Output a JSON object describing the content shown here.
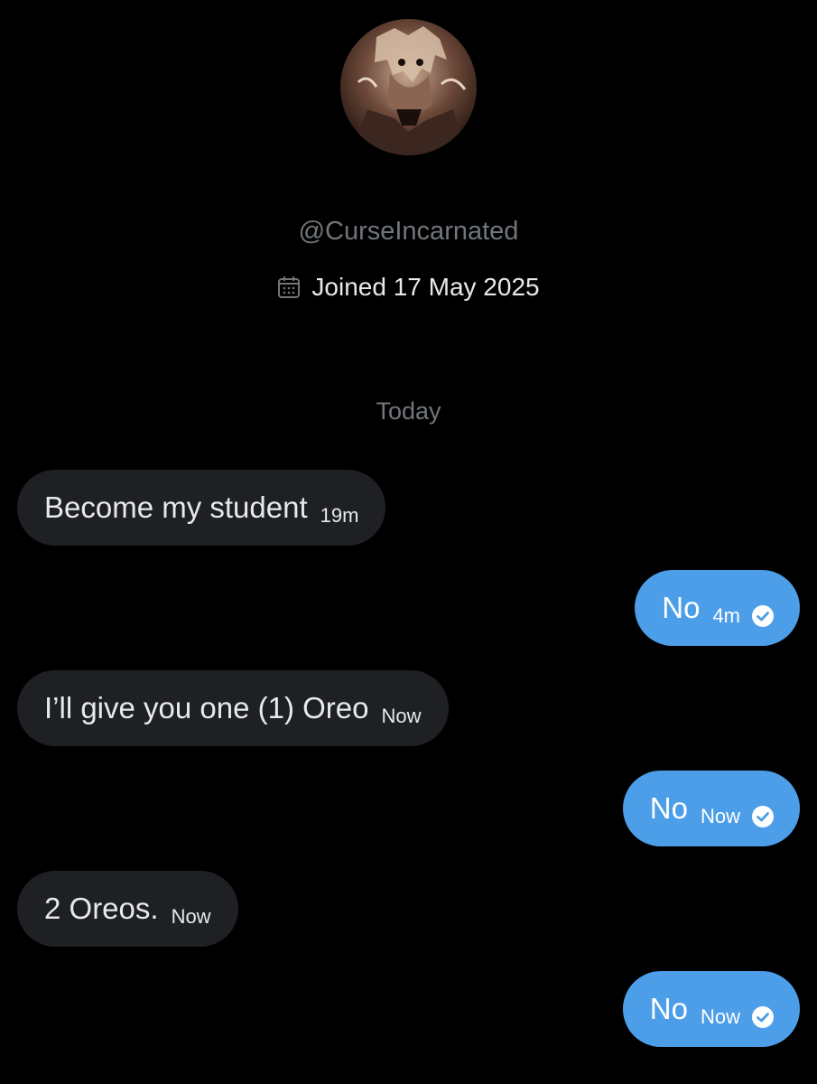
{
  "profile": {
    "avatar_icon": "profile-avatar-image",
    "handle": "@CurseIncarnated",
    "joined": "Joined 17 May 2025"
  },
  "date_separator": "Today",
  "colors": {
    "background": "#000000",
    "incoming_bubble": "#1f2023",
    "outgoing_bubble": "#4c9ee8",
    "muted_text": "#71767b"
  },
  "messages": [
    {
      "direction": "in",
      "text": "Become my student",
      "time": "19m"
    },
    {
      "direction": "out",
      "text": "No",
      "time": "4m",
      "status_icon": "read-check-icon"
    },
    {
      "direction": "in",
      "text": "I’ll give you one (1) Oreo",
      "time": "Now"
    },
    {
      "direction": "out",
      "text": "No",
      "time": "Now",
      "status_icon": "read-check-icon"
    },
    {
      "direction": "in",
      "text": "2 Oreos.",
      "time": "Now"
    },
    {
      "direction": "out",
      "text": "No",
      "time": "Now",
      "status_icon": "read-check-icon"
    }
  ]
}
